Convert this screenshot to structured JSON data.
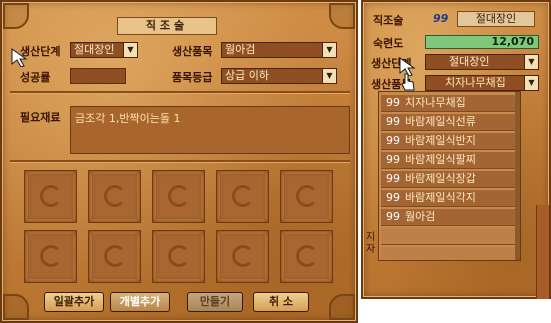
{
  "main": {
    "title": "직조술",
    "labels": {
      "rank": "생산단계",
      "product": "생산품목",
      "success_rate": "성공률",
      "grade": "품목등급",
      "materials": "필요재료"
    },
    "rank_select": "절대장인",
    "product_select": "월아검",
    "success_rate_value": "",
    "grade_select": "상급 이하",
    "materials_text": "금조각 1,반짝이는돌 1",
    "buttons": {
      "batch_add": "일괄추가",
      "single_add": "개별추가",
      "make": "만들기",
      "cancel": "취 소"
    }
  },
  "side": {
    "title": "직조술",
    "level": "99",
    "rank": "절대장인",
    "proficiency_label": "숙련도",
    "proficiency_value": "12,070",
    "proficiency_ratio": 1.0,
    "rank_label": "생산단계",
    "rank_select": "절대장인",
    "product_label": "생산품목",
    "product_select": "치자나무채집",
    "items": [
      {
        "num": "99",
        "name": "치자나무채집"
      },
      {
        "num": "99",
        "name": "바람제일식선류"
      },
      {
        "num": "99",
        "name": "바람제일식반지"
      },
      {
        "num": "99",
        "name": "바람제일식팔찌"
      },
      {
        "num": "99",
        "name": "바람제일식장갑"
      },
      {
        "num": "99",
        "name": "바람제일식각지"
      },
      {
        "num": "99",
        "name": "월아검"
      }
    ],
    "edge_text": "지자"
  },
  "colors": {
    "panel": "#c4803a",
    "border": "#6b3a12",
    "input_bg": "#8f4f22",
    "list_item": "#a36533",
    "proficiency_bar": "#7fc87b",
    "level_text": "#1f3b8c"
  }
}
